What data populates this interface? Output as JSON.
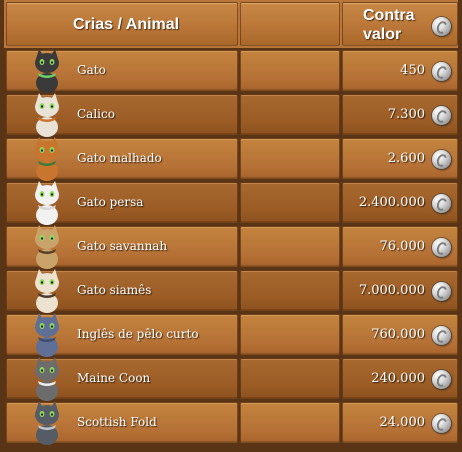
{
  "header": {
    "animal_label": "Crias / Animal",
    "value_label_line1": "Contra",
    "value_label_line2": "valor",
    "coin_icon": "silver-coin-icon"
  },
  "rows": [
    {
      "name": "Gato",
      "price": "450",
      "cat_color": "#3a3a3a",
      "accent": "#6ad06a"
    },
    {
      "name": "Calico",
      "price": "7.300",
      "cat_color": "#e9e2d6",
      "accent": "#c9732f"
    },
    {
      "name": "Gato malhado",
      "price": "2.600",
      "cat_color": "#c8762e",
      "accent": "#3c7a3c"
    },
    {
      "name": "Gato persa",
      "price": "2.400.000",
      "cat_color": "#f1f1ef",
      "accent": "#d8d8d8"
    },
    {
      "name": "Gato savannah",
      "price": "76.000",
      "cat_color": "#c9a36a",
      "accent": "#5a4025"
    },
    {
      "name": "Gato siamês",
      "price": "7.000.000",
      "cat_color": "#ece2cf",
      "accent": "#4a3a2c"
    },
    {
      "name": "Inglês de pêlo curto",
      "price": "760.000",
      "cat_color": "#5f6f96",
      "accent": "#3f4c70"
    },
    {
      "name": "Maine Coon",
      "price": "240.000",
      "cat_color": "#6c6c6c",
      "accent": "#efefef"
    },
    {
      "name": "Scottish Fold",
      "price": "24.000",
      "cat_color": "#555c66",
      "accent": "#c0c6cc"
    }
  ]
}
